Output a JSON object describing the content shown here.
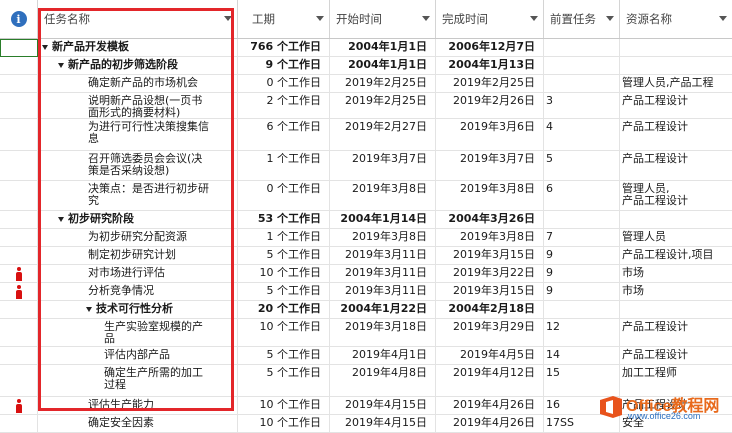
{
  "header": {
    "info_icon_glyph": "i",
    "columns": [
      "任务名称",
      "工期",
      "开始时间",
      "完成时间",
      "前置任务",
      "资源名称"
    ]
  },
  "rows": [
    {
      "level": 0,
      "summary": true,
      "name": "新产品开发模板",
      "duration": "766 个工作日",
      "start": "2004年1月1日",
      "finish": "2006年12月7日",
      "pred": "",
      "res": "",
      "icon": false
    },
    {
      "level": 1,
      "summary": true,
      "name": "新产品的初步筛选阶段",
      "duration": "9 个工作日",
      "start": "2004年1月1日",
      "finish": "2004年1月13日",
      "pred": "",
      "res": "",
      "icon": false
    },
    {
      "level": 2,
      "summary": false,
      "name": "确定新产品的市场机会",
      "duration": "0 个工作日",
      "start": "2019年2月25日",
      "finish": "2019年2月25日",
      "pred": "",
      "res": "管理人员,产品工程",
      "icon": false
    },
    {
      "level": 2,
      "summary": false,
      "name": "说明新产品设想(一页书\n面形式的摘要材料)",
      "duration": "2 个工作日",
      "start": "2019年2月25日",
      "finish": "2019年2月26日",
      "pred": "3",
      "res": "产品工程设计",
      "icon": false
    },
    {
      "level": 2,
      "summary": false,
      "name": "为进行可行性决策搜集信\n息",
      "duration": "6 个工作日",
      "start": "2019年2月27日",
      "finish": "2019年3月6日",
      "pred": "4",
      "res": "产品工程设计",
      "icon": false
    },
    {
      "level": 2,
      "summary": false,
      "name": "召开筛选委员会会议(决\n策是否采纳设想)",
      "duration": "1 个工作日",
      "start": "2019年3月7日",
      "finish": "2019年3月7日",
      "pred": "5",
      "res": "产品工程设计",
      "icon": false
    },
    {
      "level": 2,
      "summary": false,
      "name": "决策点：是否进行初步研\n究",
      "duration": "0 个工作日",
      "start": "2019年3月8日",
      "finish": "2019年3月8日",
      "pred": "6",
      "res": "管理人员,\n产品工程设计",
      "icon": false
    },
    {
      "level": 1,
      "summary": true,
      "name": "初步研究阶段",
      "duration": "53 个工作日",
      "start": "2004年1月14日",
      "finish": "2004年3月26日",
      "pred": "",
      "res": "",
      "icon": false
    },
    {
      "level": 2,
      "summary": false,
      "name": "为初步研究分配资源",
      "duration": "1 个工作日",
      "start": "2019年3月8日",
      "finish": "2019年3月8日",
      "pred": "7",
      "res": "管理人员",
      "icon": false
    },
    {
      "level": 2,
      "summary": false,
      "name": "制定初步研究计划",
      "duration": "5 个工作日",
      "start": "2019年3月11日",
      "finish": "2019年3月15日",
      "pred": "9",
      "res": "产品工程设计,项目",
      "icon": false
    },
    {
      "level": 2,
      "summary": false,
      "name": "对市场进行评估",
      "duration": "10 个工作日",
      "start": "2019年3月11日",
      "finish": "2019年3月22日",
      "pred": "9",
      "res": "市场",
      "icon": true
    },
    {
      "level": 2,
      "summary": false,
      "name": "分析竞争情况",
      "duration": "5 个工作日",
      "start": "2019年3月11日",
      "finish": "2019年3月15日",
      "pred": "9",
      "res": "市场",
      "icon": true
    },
    {
      "level": 2,
      "summary": true,
      "name": "技术可行性分析",
      "duration": "20 个工作日",
      "start": "2004年1月22日",
      "finish": "2004年2月18日",
      "pred": "",
      "res": "",
      "icon": false
    },
    {
      "level": 3,
      "summary": false,
      "name": "生产实验室规模的产\n品",
      "duration": "10 个工作日",
      "start": "2019年3月18日",
      "finish": "2019年3月29日",
      "pred": "12",
      "res": "产品工程设计",
      "icon": false
    },
    {
      "level": 3,
      "summary": false,
      "name": "评估内部产品",
      "duration": "5 个工作日",
      "start": "2019年4月1日",
      "finish": "2019年4月5日",
      "pred": "14",
      "res": "产品工程设计",
      "icon": false
    },
    {
      "level": 3,
      "summary": false,
      "name": "确定生产所需的加工\n过程",
      "duration": "5 个工作日",
      "start": "2019年4月8日",
      "finish": "2019年4月12日",
      "pred": "15",
      "res": "加工工程师",
      "icon": false
    },
    {
      "level": 2,
      "summary": false,
      "name": "评估生产能力",
      "duration": "10 个工作日",
      "start": "2019年4月15日",
      "finish": "2019年4月26日",
      "pred": "16",
      "res": "产品工程设计",
      "icon": true
    },
    {
      "level": 2,
      "summary": false,
      "name": "确定安全因素",
      "duration": "10 个工作日",
      "start": "2019年4月15日",
      "finish": "2019年4月26日",
      "pred": "17SS",
      "res": "安全",
      "icon": false
    }
  ],
  "watermark": {
    "title": "Office教程网",
    "url": "www.office26.com"
  }
}
